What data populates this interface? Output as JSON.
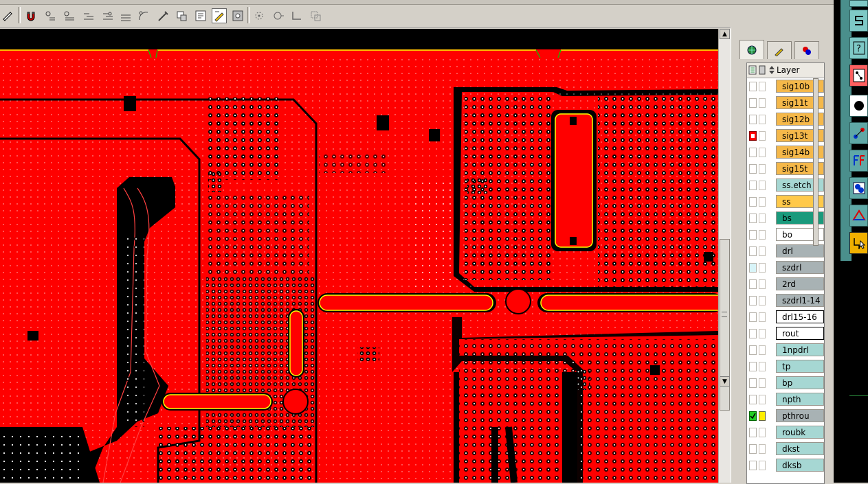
{
  "toolbar": {
    "icons": [
      "layer-edit-icon",
      "magnet-icon",
      "snap-point-icon",
      "snap-line-icon",
      "snap-edge-icon",
      "snap-mid-icon",
      "snap-arc-icon",
      "probe-icon",
      "place-icon",
      "properties-icon",
      "edit-icon",
      "settings-icon",
      "zoom-icon",
      "rotate-icon",
      "corner-icon",
      "group-icon"
    ]
  },
  "canvas": {
    "description_colors": {
      "copper": "#ff0000",
      "void": "#000000",
      "outline": "#ffff00",
      "via": "#ffffff"
    }
  },
  "panel": {
    "tabs": [
      "layers-tab",
      "edit-tab",
      "display-tab"
    ],
    "header_label": "Layer",
    "layers": [
      {
        "name": "sig10b",
        "color": "#f5b84a"
      },
      {
        "name": "sig11t",
        "color": "#f5b84a"
      },
      {
        "name": "sig12b",
        "color": "#f5b84a"
      },
      {
        "name": "sig13t",
        "color": "#f5b84a",
        "marked": "red"
      },
      {
        "name": "sig14b",
        "color": "#f5b84a"
      },
      {
        "name": "sig15t",
        "color": "#f5b84a"
      },
      {
        "name": "ss.etch",
        "color": "#a6d7d3"
      },
      {
        "name": "ss",
        "color": "#ffc94a"
      },
      {
        "name": "bs",
        "color": "#1a9a7c"
      },
      {
        "name": "bo",
        "color": "#ffffff"
      },
      {
        "name": "drl",
        "color": "#a8b2b4"
      },
      {
        "name": "szdrl",
        "color": "#a8b2b4",
        "marked": "cyan"
      },
      {
        "name": "2rd",
        "color": "#a8b2b4"
      },
      {
        "name": "szdrl1-14",
        "color": "#a8b2b4"
      },
      {
        "name": "drl15-16",
        "color": "#ffffff",
        "boxed": true
      },
      {
        "name": "rout",
        "color": "#ffffff",
        "boxed": true
      },
      {
        "name": "1npdrl",
        "color": "#a6d7d3"
      },
      {
        "name": "tp",
        "color": "#a6d7d3"
      },
      {
        "name": "bp",
        "color": "#a6d7d3"
      },
      {
        "name": "npth",
        "color": "#a6d7d3"
      },
      {
        "name": "pthrou",
        "color": "#a8b2b4",
        "marked": "green"
      },
      {
        "name": "roubk",
        "color": "#a6d7d3"
      },
      {
        "name": "dkst",
        "color": "#a6d7d3"
      },
      {
        "name": "dksb",
        "color": "#a6d7d3"
      }
    ]
  },
  "right_strip": {
    "icons": [
      "square-icon",
      "s-shape-icon",
      "help-icon",
      "component-icon",
      "dot-icon",
      "connect-icon",
      "f-icon",
      "group-icon",
      "triangle-icon",
      "route-icon"
    ]
  }
}
